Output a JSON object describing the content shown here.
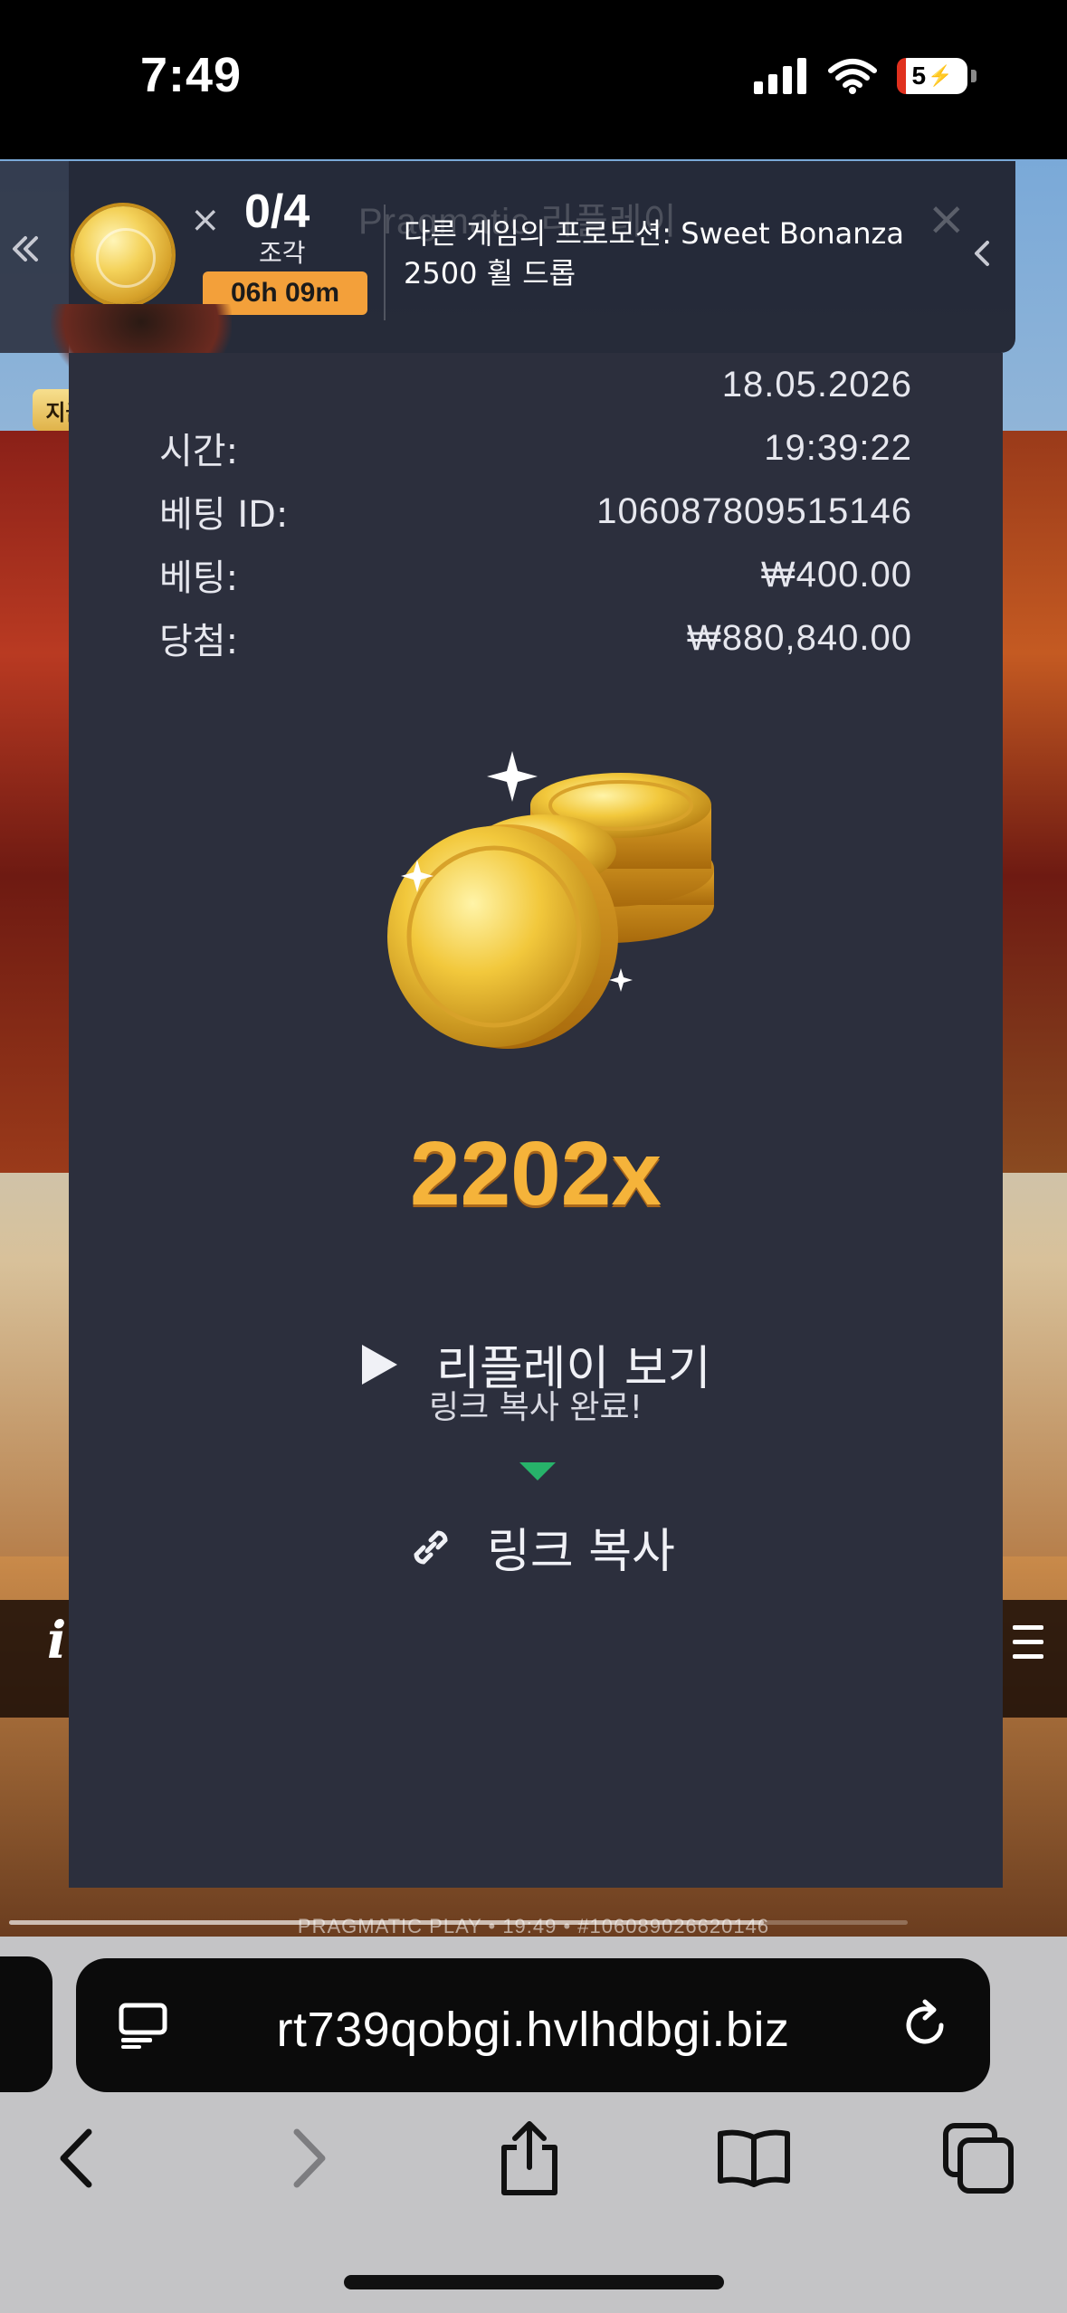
{
  "status_bar": {
    "time": "7:49",
    "battery": "5"
  },
  "promo": {
    "pieces_count": "0/4",
    "pieces_label": "조각",
    "timer": "06h 09m",
    "ghost_title": "Pragmatic 리플레이",
    "message": "다른 게임의 프로모션: Sweet Bonanza 2500 휠 드롭",
    "baccarat_button": "지금 바카라 플레이"
  },
  "replay": {
    "details": [
      {
        "label": "",
        "value": "18.05.2026"
      },
      {
        "label": "시간:",
        "value": "19:39:22"
      },
      {
        "label": "베팅 ID:",
        "value": "106087809515146"
      },
      {
        "label": "베팅:",
        "value": "₩400.00"
      },
      {
        "label": "당첨:",
        "value": "₩880,840.00"
      }
    ],
    "multiplier": "2202x",
    "view_replay_label": "리플레이 보기",
    "copied_toast": "링크 복사 완료!",
    "copy_link_label": "링크 복사"
  },
  "game_footer": {
    "text": "PRAGMATIC PLAY • 19:49 • #106089026620146",
    "progress": 0.84
  },
  "browser": {
    "url": "rt739qobgi.hvlhdbgi.biz"
  },
  "colors": {
    "panel_bg": "#2c2f3d",
    "multiplier": "#f5b33a",
    "timer_badge": "#f3a03a",
    "toast_arrow": "#27b36a"
  }
}
